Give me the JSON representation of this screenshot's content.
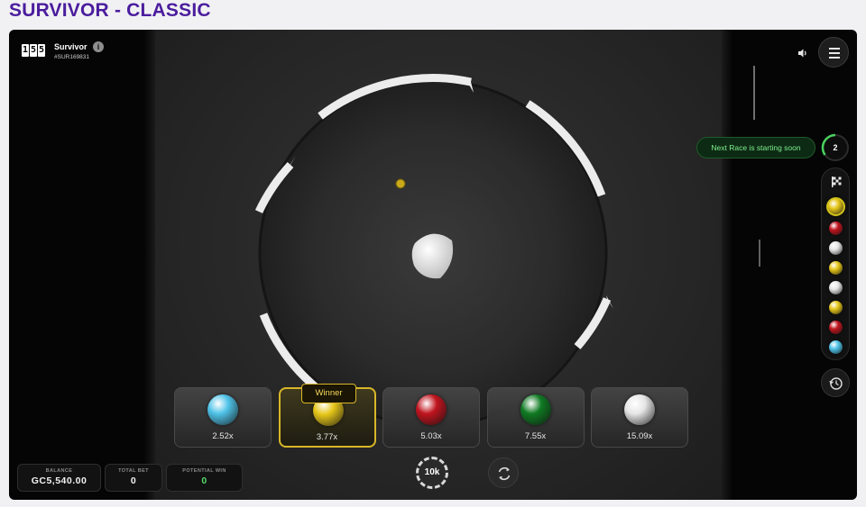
{
  "page": {
    "title": "SURVIVOR - CLASSIC"
  },
  "game": {
    "logo_digits": [
      "1",
      "5",
      "5"
    ],
    "name": "Survivor",
    "race_id": "#SUR169831"
  },
  "status": {
    "message": "Next Race is starting soon",
    "countdown": "2"
  },
  "colors": {
    "accent_purple": "#4b1d9e",
    "winner_gold": "#d8b629",
    "status_green": "#55d96a",
    "ball_blue": "#4fc3e8",
    "ball_yellow": "#e6c619",
    "ball_red": "#c0141e",
    "ball_green": "#0f7a22",
    "ball_white": "#e6e6e6"
  },
  "results_history": [
    "yellow",
    "red",
    "white",
    "yellow",
    "white",
    "yellow",
    "red",
    "blue"
  ],
  "bets": [
    {
      "ball": "blue",
      "odds": "2.52x",
      "winner": false
    },
    {
      "ball": "yellow",
      "odds": "3.77x",
      "winner": true
    },
    {
      "ball": "red",
      "odds": "5.03x",
      "winner": false
    },
    {
      "ball": "green",
      "odds": "7.55x",
      "winner": false
    },
    {
      "ball": "white",
      "odds": "15.09x",
      "winner": false
    }
  ],
  "winner_label": "Winner",
  "footer": {
    "balance_label": "BALANCE",
    "balance": "GC5,540.00",
    "total_bet_label": "TOTAL BET",
    "total_bet": "0",
    "potential_win_label": "POTENTIAL WIN",
    "potential_win": "0",
    "chip": "10k"
  },
  "icons": {
    "info": "info-icon",
    "sound": "speaker-icon",
    "menu": "hamburger-menu-icon",
    "flag": "checkered-flag-icon",
    "history": "history-clock-icon",
    "repeat": "repeat-arrows-icon"
  }
}
